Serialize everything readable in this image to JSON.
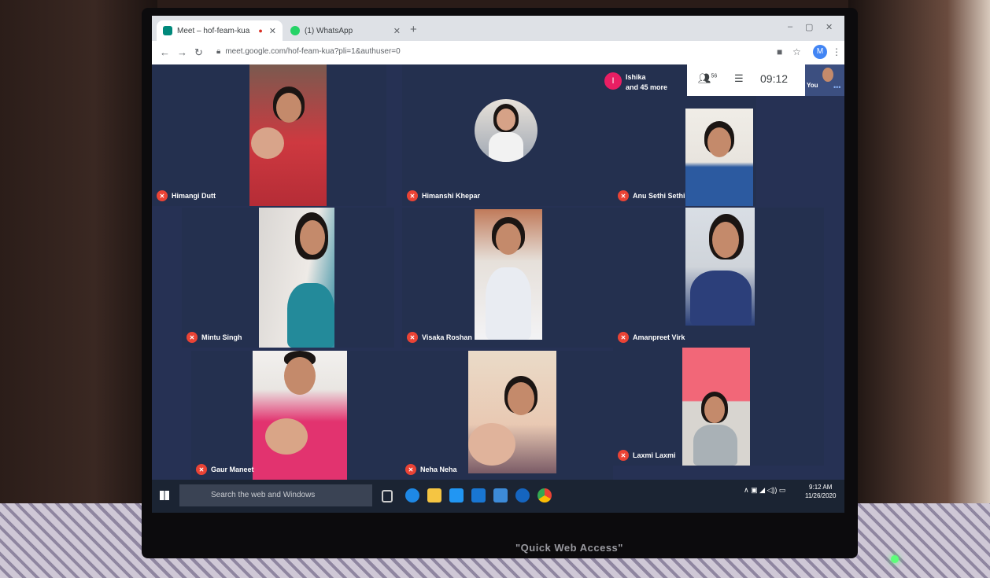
{
  "browser": {
    "tabs": [
      {
        "title": "Meet – hof-feam-kua",
        "active": true
      },
      {
        "title": "(1) WhatsApp",
        "active": false
      }
    ],
    "url": "meet.google.com/hof-feam-kua?pli=1&authuser=0",
    "profile_initial": "M"
  },
  "meet": {
    "participants": [
      {
        "name": "Himangi Dutt"
      },
      {
        "name": "Himanshi Khepar"
      },
      {
        "name": "Anu Sethi Sethi"
      },
      {
        "name": "Mintu Singh"
      },
      {
        "name": "Visaka Roshan"
      },
      {
        "name": "Amanpreet Virk"
      },
      {
        "name": "Gaur Maneet"
      },
      {
        "name": "Neha Neha"
      },
      {
        "name": "Laxmi Laxmi"
      }
    ],
    "more": {
      "avatar_initial": "I",
      "line1": "Ishika",
      "line2": "and 45 more"
    },
    "participant_count": "56",
    "clock": "09:12",
    "self_label": "You"
  },
  "taskbar": {
    "search_placeholder": "Search the web and Windows",
    "time": "9:12 AM",
    "date": "11/26/2020"
  },
  "monitor": {
    "brand_text": "\"Quick Web Access\""
  }
}
